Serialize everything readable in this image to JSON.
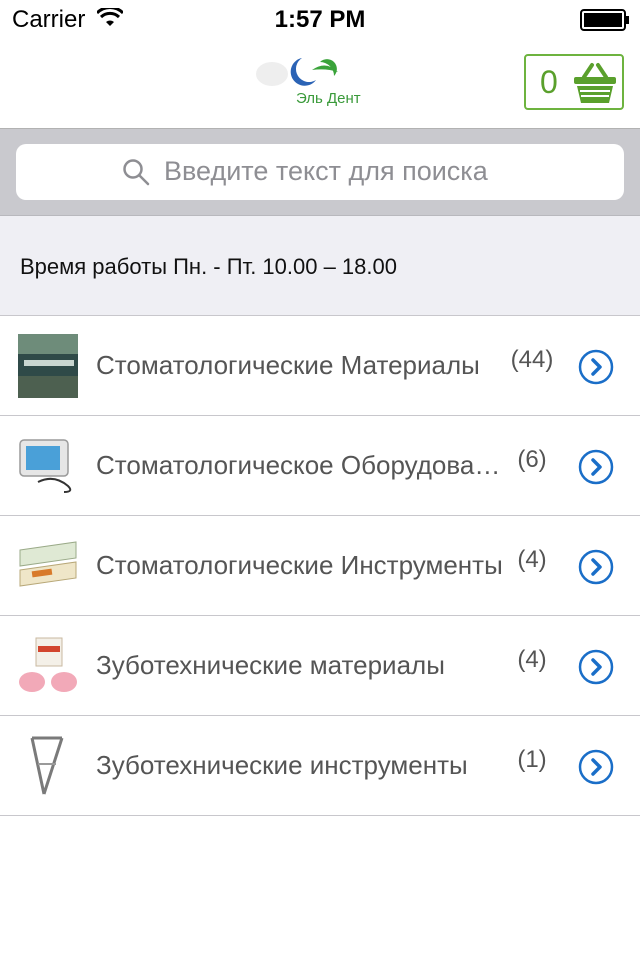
{
  "status_bar": {
    "carrier": "Carrier",
    "time": "1:57 PM"
  },
  "header": {
    "logo_text": "Эль Дент",
    "cart_count": "0",
    "accent_color": "#6db33f"
  },
  "search": {
    "placeholder": "Введите текст для поиска"
  },
  "hours": {
    "text": "Время работы Пн. - Пт. 10.00 – 18.00"
  },
  "categories": [
    {
      "title": "Стоматологические Материалы",
      "count": "(44)",
      "thumb_icon": "dental-materials-thumb"
    },
    {
      "title": "Стоматологическое Оборудование",
      "count": "(6)",
      "thumb_icon": "dental-equipment-thumb"
    },
    {
      "title": "Стоматологические Инструменты",
      "count": "(4)",
      "thumb_icon": "dental-instruments-thumb"
    },
    {
      "title": "Зуботехнические материалы",
      "count": "(4)",
      "thumb_icon": "lab-materials-thumb"
    },
    {
      "title": "Зуботехнические инструменты",
      "count": "(1)",
      "thumb_icon": "lab-instruments-thumb"
    }
  ],
  "icons": {
    "disclosure": "chevron-right-circle-icon",
    "search": "search-icon",
    "cart": "basket-icon"
  }
}
